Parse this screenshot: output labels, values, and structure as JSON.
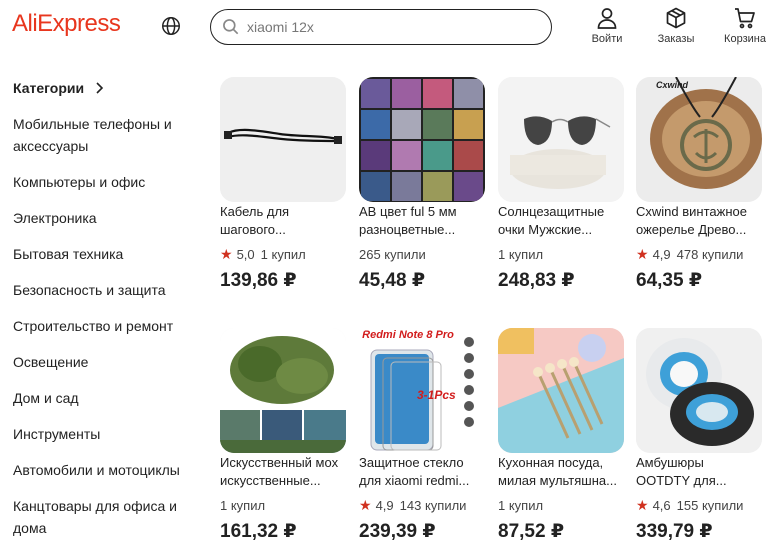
{
  "header": {
    "logo": "AliExpress",
    "search_value": "xiaomi 12x",
    "buttons": [
      {
        "label": "Войти",
        "icon": "user-icon"
      },
      {
        "label": "Заказы",
        "icon": "box-icon"
      },
      {
        "label": "Корзина",
        "icon": "cart-icon"
      }
    ]
  },
  "sidebar": {
    "title": "Категории",
    "items": [
      {
        "line1": "Мобильные телефоны и",
        "line2": "аксессуары"
      },
      {
        "line1": "Компьютеры и офис",
        "line2": ""
      },
      {
        "line1": "Электроника",
        "line2": ""
      },
      {
        "line1": "Бытовая техника",
        "line2": ""
      },
      {
        "line1": "Безопасность и защита",
        "line2": ""
      },
      {
        "line1": "Строительство и ремонт",
        "line2": ""
      },
      {
        "line1": "Освещение",
        "line2": ""
      },
      {
        "line1": "Дом и сад",
        "line2": ""
      },
      {
        "line1": "Инструменты",
        "line2": ""
      },
      {
        "line1": "Автомобили и мотоциклы",
        "line2": ""
      },
      {
        "line1": "Канцтовары для офиса и",
        "line2": "дома"
      }
    ]
  },
  "products": [
    {
      "title1": "Кабель для",
      "title2": "шагового...",
      "rating": "5,0",
      "sold": "1 купил",
      "price": "139,86 ₽"
    },
    {
      "title1": "AB цвет ful 5 мм",
      "title2": "разноцветные...",
      "rating": "",
      "sold": "265 купили",
      "price": "45,48 ₽"
    },
    {
      "title1": "Солнцезащитные",
      "title2": "очки Мужские...",
      "rating": "",
      "sold": "1 купил",
      "price": "248,83 ₽"
    },
    {
      "title1": "Cxwind винтажное",
      "title2": "ожерелье Древо...",
      "rating": "4,9",
      "sold": "478 купили",
      "price": "64,35 ₽"
    },
    {
      "title1": "Искусственный мох",
      "title2": "искусственные...",
      "rating": "",
      "sold": "1 купил",
      "price": "161,32 ₽"
    },
    {
      "title1": "Защитное стекло",
      "title2": "для xiaomi redmi...",
      "rating": "4,9",
      "sold": "143 купили",
      "price": "239,39 ₽"
    },
    {
      "title1": "Кухонная посуда,",
      "title2": "милая мультяшна...",
      "rating": "",
      "sold": "1 купил",
      "price": "87,52 ₽"
    },
    {
      "title1": "Амбушюры",
      "title2": "OOTDTY для...",
      "rating": "4,6",
      "sold": "155 купили",
      "price": "339,79 ₽"
    }
  ],
  "image_text": {
    "redmi_banner": "Redmi Note 8 Pro",
    "pcs_badge": "3-1Pcs",
    "cxwind_logo": "Cxwind"
  },
  "colors": {
    "brand": "#e8361e",
    "star": "#d0311f"
  }
}
